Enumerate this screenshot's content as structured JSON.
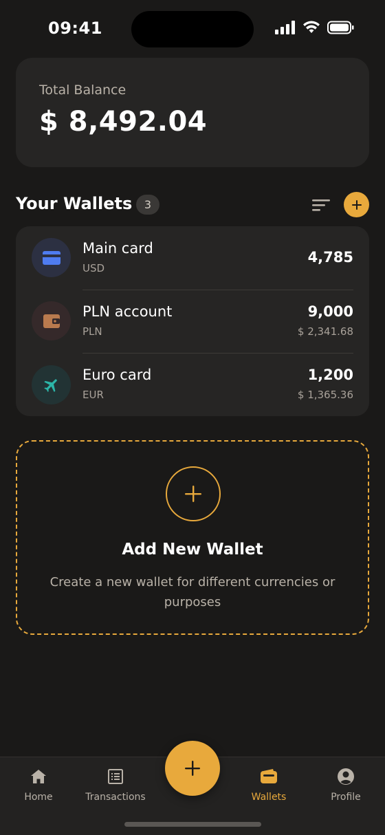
{
  "status_bar": {
    "time": "09:41",
    "icons": [
      "signal-icon",
      "wifi-icon",
      "battery-icon"
    ]
  },
  "balance": {
    "label": "Total Balance",
    "value": "$ 8,492.04"
  },
  "wallets_section": {
    "title": "Your Wallets",
    "count": "3",
    "sort_icon": "sort-icon",
    "add_icon": "plus-icon"
  },
  "wallets": [
    {
      "name": "Main card",
      "currency": "USD",
      "amount": "4,785",
      "converted": "",
      "icon": "credit-card-icon",
      "icon_color": "#4f7cf0",
      "icon_bg": "#2c3042"
    },
    {
      "name": "PLN account",
      "currency": "PLN",
      "amount": "9,000",
      "converted": "$ 2,341.68",
      "icon": "wallet-icon",
      "icon_color": "#b97a4e",
      "icon_bg": "#35292a"
    },
    {
      "name": "Euro card",
      "currency": "EUR",
      "amount": "1,200",
      "converted": "$ 1,365.36",
      "icon": "airplane-icon",
      "icon_color": "#2cb5a8",
      "icon_bg": "#223334"
    }
  ],
  "add_wallet": {
    "title": "Add New Wallet",
    "description": "Create a new wallet for different currencies or purposes"
  },
  "nav": {
    "items": [
      {
        "label": "Home",
        "icon": "home-icon",
        "active": false
      },
      {
        "label": "Transactions",
        "icon": "receipt-icon",
        "active": false
      },
      {
        "label": "Wallets",
        "icon": "wallet-icon",
        "active": true
      },
      {
        "label": "Profile",
        "icon": "profile-icon",
        "active": false
      }
    ]
  },
  "colors": {
    "accent": "#e8a93c",
    "background": "#1a1918",
    "card": "#262524",
    "text_secondary": "#a9a29a"
  }
}
